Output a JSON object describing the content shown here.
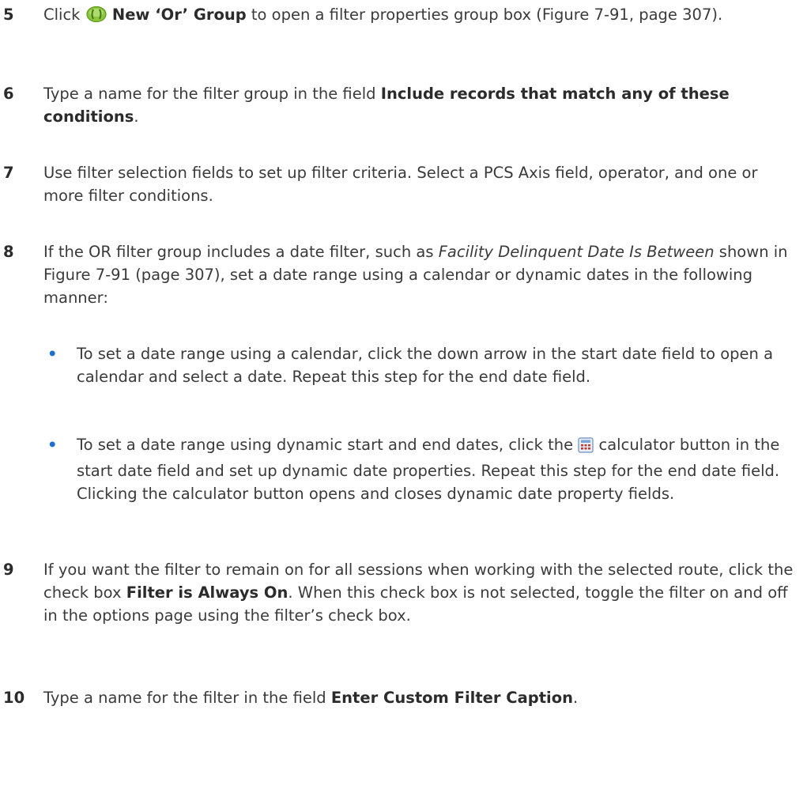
{
  "steps": [
    {
      "num": "5",
      "pre": "Click",
      "bold": "New ‘Or’ Group",
      "post": " to open a filter properties group box (Figure 7-91, page 307)."
    },
    {
      "num": "6",
      "pre": "Type a name for the filter group in the field ",
      "bold": "Include records that match any of these conditions",
      "post": "."
    },
    {
      "num": "7",
      "text": "Use filter selection fields to set up filter criteria. Select a PCS Axis field, operator, and one or more filter conditions."
    },
    {
      "num": "8",
      "pre": "If the OR filter group includes a date filter, such as ",
      "italic": "Facility Delinquent Date Is Between",
      "post": " shown in Figure 7-91 (page 307), set a date range using a calendar or dynamic dates in the following manner:"
    },
    {
      "num": "9",
      "pre": "If you want the filter to remain on for all sessions when working with the selected route, click the check box ",
      "bold": "Filter is Always On",
      "post": ". When this check box is not selected, toggle the filter on and off in the options page using the filter’s check box."
    },
    {
      "num": "10",
      "pre": "Type a name for the filter in the field ",
      "bold": "Enter Custom Filter Caption",
      "post": "."
    }
  ],
  "bullets": [
    {
      "marker": "•",
      "text": "To set a date range using a calendar, click the down arrow in the start date field to open a calendar and select a date. Repeat this step for the end date field."
    },
    {
      "marker": "•",
      "pre": "To set a date range using dynamic start and end dates, click the ",
      "post": " calculator button in the start date field and set up dynamic date properties. Repeat this step for the end date field. Clicking the calculator button opens and closes dynamic date property fields."
    }
  ],
  "icons": {
    "or_group": "or-group-icon",
    "calculator": "calculator-icon"
  }
}
